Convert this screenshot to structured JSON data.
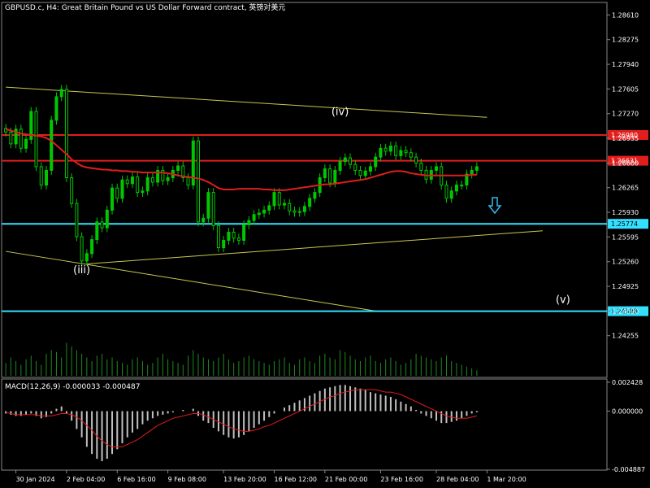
{
  "header": {
    "title": "GBPUSD.c, H4:  Great Britain Pound vs US Dollar Forward contract, 英镑对美元"
  },
  "macd": {
    "label": "MACD(12,26,9) -0.000033 -0.000487",
    "ticks": [
      "0.002428",
      "0.000000",
      "-0.004887"
    ]
  },
  "colors": {
    "background": "#000000",
    "candles": "#00c800",
    "ma": "#e11d1d",
    "levels_red": "#e11d1d",
    "levels_cyan": "#33e0ff",
    "trend": "#c8c850",
    "macd_hist": "#c0c0c0",
    "macd_signal": "#e11d1d",
    "volume": "#1f8a1f",
    "arrow": "#33bbee"
  },
  "chart_data": {
    "type": "candlestick",
    "symbol": "GBPUSD.c",
    "timeframe": "H4",
    "ylim": [
      1.237,
      1.2878
    ],
    "y_ticks": [
      "1.28610",
      "1.28275",
      "1.27940",
      "1.27605",
      "1.27270",
      "1.26935",
      "1.26600",
      "1.26265",
      "1.25930",
      "1.25595",
      "1.25260",
      "1.24925",
      "1.24590",
      "1.24255"
    ],
    "x_ticks": [
      "30 Jan 2024",
      "2 Feb 04:00",
      "6 Feb 16:00",
      "9 Feb 08:00",
      "13 Feb 20:00",
      "16 Feb 12:00",
      "21 Feb 00:00",
      "23 Feb 16:00",
      "28 Feb 04:00",
      "1 Mar 20:00"
    ],
    "levels": [
      {
        "value": 1.2698,
        "label": "1.26980",
        "color": "red"
      },
      {
        "value": 1.26631,
        "label": "1.26631",
        "color": "red"
      },
      {
        "value": 1.25774,
        "label": "1.25774",
        "color": "cyan"
      },
      {
        "value": 1.24588,
        "label": "1.24588",
        "color": "cyan"
      }
    ],
    "wave_labels": [
      {
        "text": "(iii)",
        "bar": 15,
        "price": 1.251
      },
      {
        "text": "(iv)",
        "bar": 66,
        "price": 1.2725
      },
      {
        "text": "(v)",
        "bar": 110,
        "price": 1.247
      }
    ],
    "trendlines": [
      {
        "from": [
          0,
          1.2763
        ],
        "to": [
          95,
          1.2722
        ]
      },
      {
        "from": [
          0,
          1.254
        ],
        "to": [
          73,
          1.2459
        ]
      },
      {
        "from": [
          16,
          1.2523
        ],
        "to": [
          106,
          1.2568
        ]
      }
    ],
    "closes": [
      1.2702,
      1.2686,
      1.2706,
      1.268,
      1.2692,
      1.273,
      1.2655,
      1.263,
      1.265,
      1.2718,
      1.275,
      1.276,
      1.264,
      1.2605,
      1.256,
      1.2527,
      1.2537,
      1.2556,
      1.258,
      1.2572,
      1.2596,
      1.2626,
      1.2612,
      1.2637,
      1.2632,
      1.2641,
      1.262,
      1.2622,
      1.264,
      1.2634,
      1.265,
      1.2636,
      1.264,
      1.265,
      1.2656,
      1.264,
      1.263,
      1.269,
      1.258,
      1.2585,
      1.262,
      1.2575,
      1.2545,
      1.2555,
      1.2566,
      1.2558,
      1.2555,
      1.2576,
      1.2582,
      1.259,
      1.2592,
      1.2596,
      1.2602,
      1.262,
      1.2603,
      1.2605,
      1.2595,
      1.2593,
      1.2594,
      1.2601,
      1.2612,
      1.262,
      1.264,
      1.2652,
      1.2633,
      1.265,
      1.2662,
      1.2667,
      1.2658,
      1.265,
      1.2643,
      1.2649,
      1.2655,
      1.2668,
      1.268,
      1.2676,
      1.2683,
      1.267,
      1.2677,
      1.2674,
      1.2668,
      1.266,
      1.265,
      1.2638,
      1.265,
      1.2655,
      1.263,
      1.2612,
      1.2622,
      1.263,
      1.263,
      1.2645,
      1.265,
      1.2655
    ],
    "ma": [
      1.2706,
      1.2704,
      1.2702,
      1.27,
      1.2699,
      1.2698,
      1.2697,
      1.2696,
      1.2694,
      1.269,
      1.2684,
      1.2678,
      1.2672,
      1.2665,
      1.266,
      1.2656,
      1.2654,
      1.2653,
      1.2652,
      1.2651,
      1.2651,
      1.265,
      1.265,
      1.2649,
      1.2649,
      1.2648,
      1.2648,
      1.2647,
      1.2647,
      1.2647,
      1.2647,
      1.2647,
      1.2646,
      1.2645,
      1.2643,
      1.2642,
      1.2641,
      1.264,
      1.2639,
      1.2637,
      1.2634,
      1.263,
      1.2626,
      1.2624,
      1.2624,
      1.2624,
      1.2625,
      1.2625,
      1.2625,
      1.2625,
      1.2625,
      1.2624,
      1.2624,
      1.2623,
      1.2623,
      1.2623,
      1.2624,
      1.2625,
      1.2626,
      1.2627,
      1.2628,
      1.2629,
      1.263,
      1.2631,
      1.2631,
      1.2632,
      1.2633,
      1.2634,
      1.2635,
      1.2636,
      1.2637,
      1.2638,
      1.264,
      1.2642,
      1.2644,
      1.2646,
      1.2648,
      1.2649,
      1.2649,
      1.2648,
      1.2646,
      1.2645,
      1.2644,
      1.2643,
      1.2643,
      1.2643,
      1.2643,
      1.2643,
      1.2643,
      1.2643,
      1.2643,
      1.2643,
      1.2644,
      1.2644
    ],
    "volume": [
      0.35,
      0.5,
      0.4,
      0.3,
      0.45,
      0.55,
      0.4,
      0.3,
      0.6,
      0.7,
      0.65,
      0.5,
      0.9,
      0.8,
      0.7,
      0.6,
      0.5,
      0.4,
      0.55,
      0.6,
      0.45,
      0.5,
      0.4,
      0.35,
      0.3,
      0.45,
      0.5,
      0.4,
      0.3,
      0.35,
      0.5,
      0.6,
      0.45,
      0.4,
      0.35,
      0.3,
      0.55,
      0.7,
      0.6,
      0.5,
      0.45,
      0.4,
      0.5,
      0.6,
      0.45,
      0.35,
      0.4,
      0.5,
      0.55,
      0.45,
      0.4,
      0.35,
      0.3,
      0.4,
      0.45,
      0.5,
      0.35,
      0.3,
      0.45,
      0.5,
      0.4,
      0.35,
      0.55,
      0.6,
      0.5,
      0.45,
      0.7,
      0.65,
      0.55,
      0.45,
      0.4,
      0.5,
      0.55,
      0.4,
      0.35,
      0.45,
      0.5,
      0.4,
      0.3,
      0.35,
      0.45,
      0.6,
      0.55,
      0.5,
      0.45,
      0.4,
      0.5,
      0.55,
      0.4,
      0.35,
      0.3,
      0.25,
      0.2,
      0.15
    ],
    "macd_hist": [
      -0.0002,
      -0.0003,
      -0.0004,
      -0.0004,
      -0.0003,
      -0.0002,
      -0.0004,
      -0.0006,
      -0.0005,
      -0.0002,
      0.0002,
      0.0004,
      -0.0002,
      -0.0008,
      -0.0015,
      -0.0022,
      -0.003,
      -0.0036,
      -0.004,
      -0.0042,
      -0.004,
      -0.0036,
      -0.0032,
      -0.0027,
      -0.0022,
      -0.0018,
      -0.0015,
      -0.0011,
      -0.0008,
      -0.0006,
      -0.0004,
      -0.0003,
      -0.0002,
      -0.0001,
      0.0,
      0.0001,
      0.0,
      0.0002,
      -0.0004,
      -0.0008,
      -0.001,
      -0.0014,
      -0.0017,
      -0.002,
      -0.0022,
      -0.0023,
      -0.0022,
      -0.002,
      -0.0017,
      -0.0014,
      -0.0011,
      -0.0008,
      -0.0005,
      -0.0002,
      0.0,
      0.0003,
      0.0005,
      0.0007,
      0.0009,
      0.0011,
      0.0013,
      0.0015,
      0.0017,
      0.0019,
      0.002,
      0.0021,
      0.0022,
      0.0022,
      0.0021,
      0.002,
      0.0019,
      0.0018,
      0.0016,
      0.0015,
      0.0014,
      0.0013,
      0.0012,
      0.001,
      0.0008,
      0.0006,
      0.0004,
      0.0001,
      -0.0002,
      -0.0004,
      -0.0006,
      -0.0008,
      -0.001,
      -0.001,
      -0.0009,
      -0.0008,
      -0.0006,
      -0.0004,
      -0.0002,
      -0.0001
    ],
    "macd_signal": [
      -0.0001,
      -0.0002,
      -0.0003,
      -0.0003,
      -0.0003,
      -0.0003,
      -0.0003,
      -0.0004,
      -0.0004,
      -0.0004,
      -0.0003,
      -0.0002,
      -0.0002,
      -0.0003,
      -0.0005,
      -0.0008,
      -0.0012,
      -0.0016,
      -0.0021,
      -0.0025,
      -0.0028,
      -0.003,
      -0.003,
      -0.003,
      -0.0028,
      -0.0026,
      -0.0024,
      -0.0021,
      -0.0018,
      -0.0015,
      -0.0012,
      -0.001,
      -0.0008,
      -0.0006,
      -0.0005,
      -0.0004,
      -0.0003,
      -0.0002,
      -0.0002,
      -0.0003,
      -0.0005,
      -0.0007,
      -0.0009,
      -0.0011,
      -0.0013,
      -0.0015,
      -0.0016,
      -0.0017,
      -0.0017,
      -0.0016,
      -0.0015,
      -0.0013,
      -0.0012,
      -0.001,
      -0.0008,
      -0.0006,
      -0.0004,
      -0.0002,
      0.0,
      0.0002,
      0.0004,
      0.0006,
      0.0008,
      0.001,
      0.0012,
      0.0013,
      0.0015,
      0.0016,
      0.0017,
      0.0018,
      0.0018,
      0.0018,
      0.0018,
      0.0018,
      0.0017,
      0.0016,
      0.0016,
      0.0015,
      0.0014,
      0.0012,
      0.001,
      0.0008,
      0.0006,
      0.0004,
      0.0002,
      0.0,
      -0.0002,
      -0.0004,
      -0.0005,
      -0.0006,
      -0.0006,
      -0.0006,
      -0.0005,
      -0.0004
    ]
  }
}
